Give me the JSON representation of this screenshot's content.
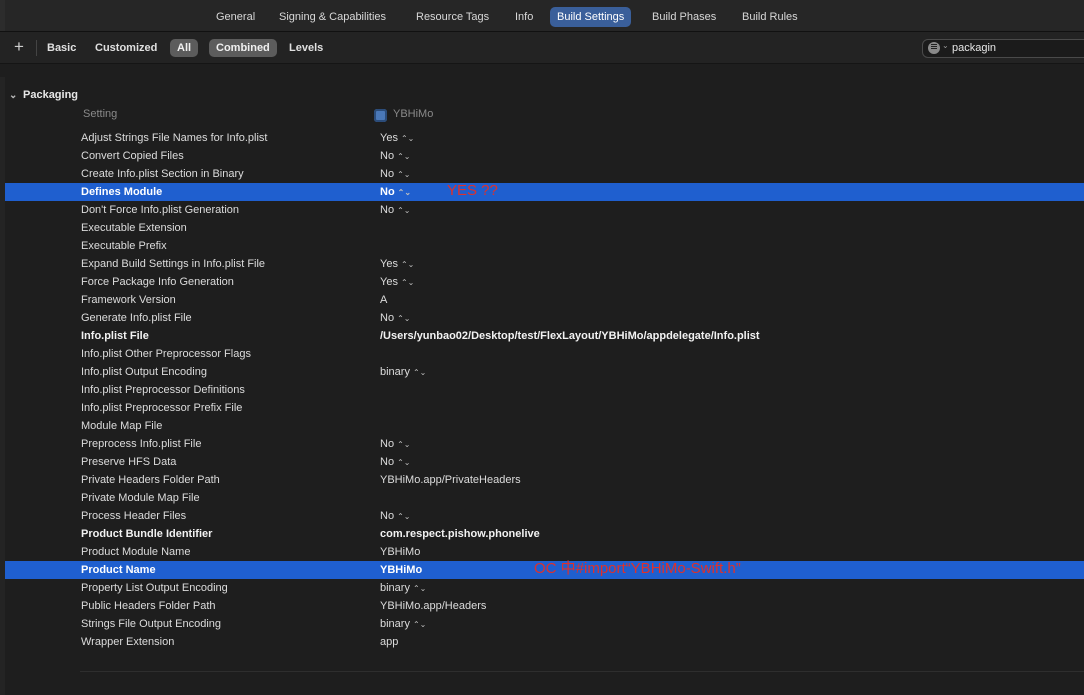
{
  "tabs": [
    "General",
    "Signing & Capabilities",
    "Resource Tags",
    "Info",
    "Build Settings",
    "Build Phases",
    "Build Rules"
  ],
  "active_tab": "Build Settings",
  "filter": {
    "add_label": "+",
    "scope": [
      "Basic",
      "Customized",
      "All"
    ],
    "view": [
      "Combined",
      "Levels"
    ],
    "search_value": "packagin"
  },
  "section": {
    "title": "Packaging",
    "col_setting": "Setting",
    "col_target": "YBHiMo"
  },
  "rows": [
    {
      "name": "Adjust Strings File Names for Info.plist",
      "value": "Yes",
      "stepper": true
    },
    {
      "name": "Convert Copied Files",
      "value": "No",
      "stepper": true
    },
    {
      "name": "Create Info.plist Section in Binary",
      "value": "No",
      "stepper": true
    },
    {
      "name": "Defines Module",
      "value": "No",
      "stepper": true,
      "bold": true,
      "selected": true,
      "note": "YES ??"
    },
    {
      "name": "Don't Force Info.plist Generation",
      "value": "No",
      "stepper": true
    },
    {
      "name": "Executable Extension",
      "value": ""
    },
    {
      "name": "Executable Prefix",
      "value": ""
    },
    {
      "name": "Expand Build Settings in Info.plist File",
      "value": "Yes",
      "stepper": true
    },
    {
      "name": "Force Package Info Generation",
      "value": "Yes",
      "stepper": true
    },
    {
      "name": "Framework Version",
      "value": "A"
    },
    {
      "name": "Generate Info.plist File",
      "value": "No",
      "stepper": true
    },
    {
      "name": "Info.plist File",
      "value": "/Users/yunbao02/Desktop/test/FlexLayout/YBHiMo/appdelegate/Info.plist",
      "bold": true
    },
    {
      "name": "Info.plist Other Preprocessor Flags",
      "value": ""
    },
    {
      "name": "Info.plist Output Encoding",
      "value": "binary",
      "stepper": true
    },
    {
      "name": "Info.plist Preprocessor Definitions",
      "value": ""
    },
    {
      "name": "Info.plist Preprocessor Prefix File",
      "value": ""
    },
    {
      "name": "Module Map File",
      "value": ""
    },
    {
      "name": "Preprocess Info.plist File",
      "value": "No",
      "stepper": true
    },
    {
      "name": "Preserve HFS Data",
      "value": "No",
      "stepper": true
    },
    {
      "name": "Private Headers Folder Path",
      "value": "YBHiMo.app/PrivateHeaders"
    },
    {
      "name": "Private Module Map File",
      "value": ""
    },
    {
      "name": "Process Header Files",
      "value": "No",
      "stepper": true
    },
    {
      "name": "Product Bundle Identifier",
      "value": "com.respect.pishow.phonelive",
      "bold": true
    },
    {
      "name": "Product Module Name",
      "value": "YBHiMo"
    },
    {
      "name": "Product Name",
      "value": "YBHiMo",
      "bold": true,
      "selected": true,
      "note": "OC 中#import“YBHiMo-Swift.h”"
    },
    {
      "name": "Property List Output Encoding",
      "value": "binary",
      "stepper": true
    },
    {
      "name": "Public Headers Folder Path",
      "value": "YBHiMo.app/Headers"
    },
    {
      "name": "Strings File Output Encoding",
      "value": "binary",
      "stepper": true
    },
    {
      "name": "Wrapper Extension",
      "value": "app"
    }
  ],
  "icons": {
    "stepper": "⌃⌄",
    "chevron": "⌄"
  }
}
